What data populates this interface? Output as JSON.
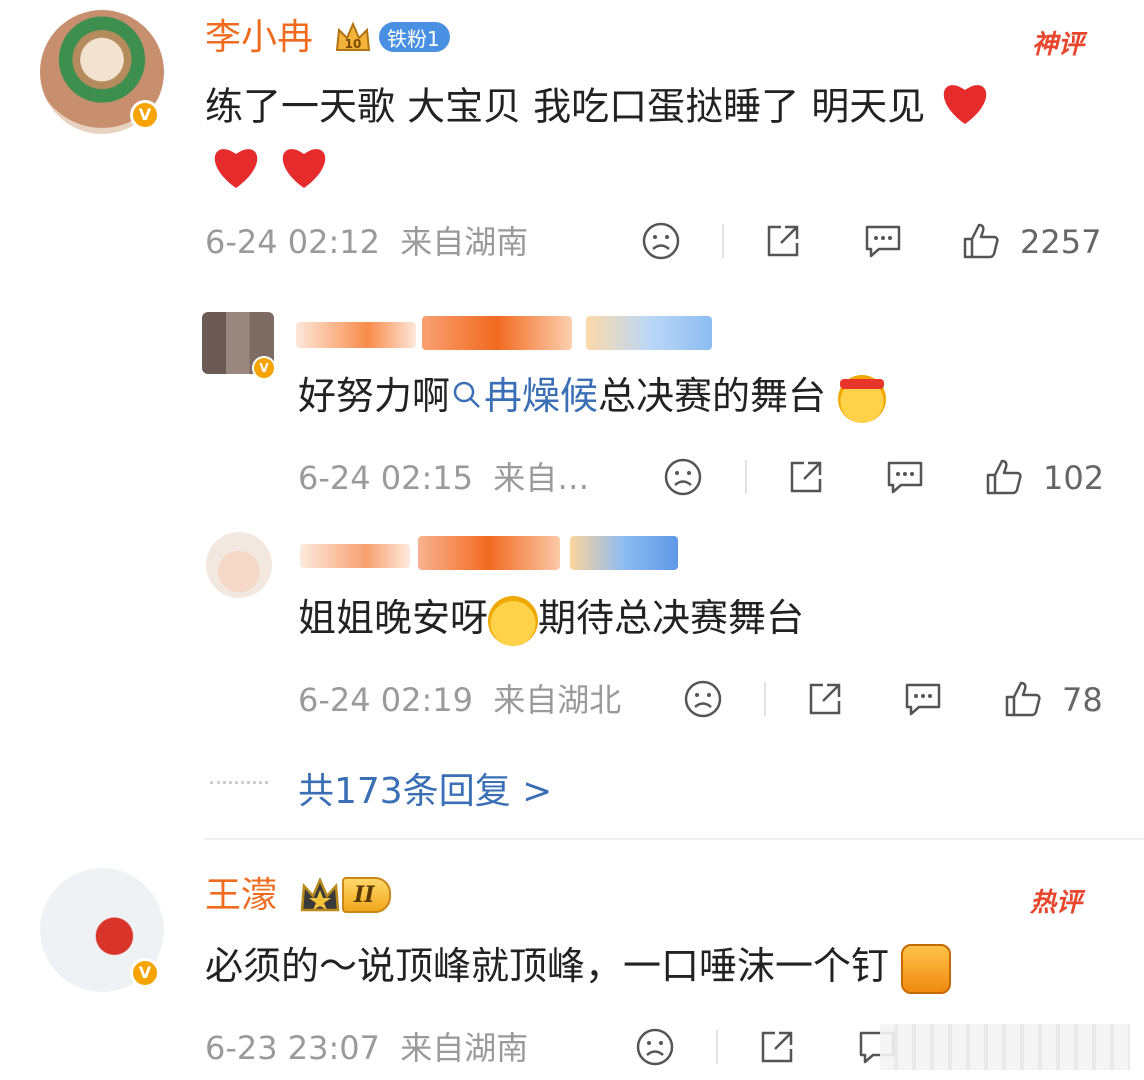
{
  "comments": [
    {
      "username": "李小冉",
      "fan_badge": "铁粉1",
      "label": "神评",
      "text": "练了一天歌 大宝贝 我吃口蛋挞睡了 明天见",
      "time": "6-24 02:12",
      "location": "来自湖南",
      "likes": "2257",
      "replies": [
        {
          "username": "",
          "text_before": "好努力啊",
          "topic": "冉燥候",
          "text_after": "总决赛的舞台",
          "time": "6-24 02:15",
          "location": "来自…",
          "likes": "102"
        },
        {
          "username": "",
          "text_before": "姐姐晚安呀",
          "text_after": "期待总决赛舞台",
          "time": "6-24 02:19",
          "location": "来自湖北",
          "likes": "78"
        }
      ],
      "more_replies": "共173条回复 >"
    },
    {
      "username": "王濛",
      "rank_badge": "II",
      "label": "热评",
      "text": "必须的～说顶峰就顶峰，一口唾沫一个钉",
      "time": "6-23 23:07",
      "location": "来自湖南"
    }
  ],
  "icons": [
    "dislike-icon",
    "share-icon",
    "comment-icon",
    "like-icon",
    "verified-icon",
    "crown-icon",
    "heart-icon",
    "search-icon"
  ],
  "colors": {
    "username": "#f06b1e",
    "verified": "#f7a300",
    "topic": "#3a6fb5",
    "hot": "#e8472e",
    "heart": "#e52b2b"
  }
}
